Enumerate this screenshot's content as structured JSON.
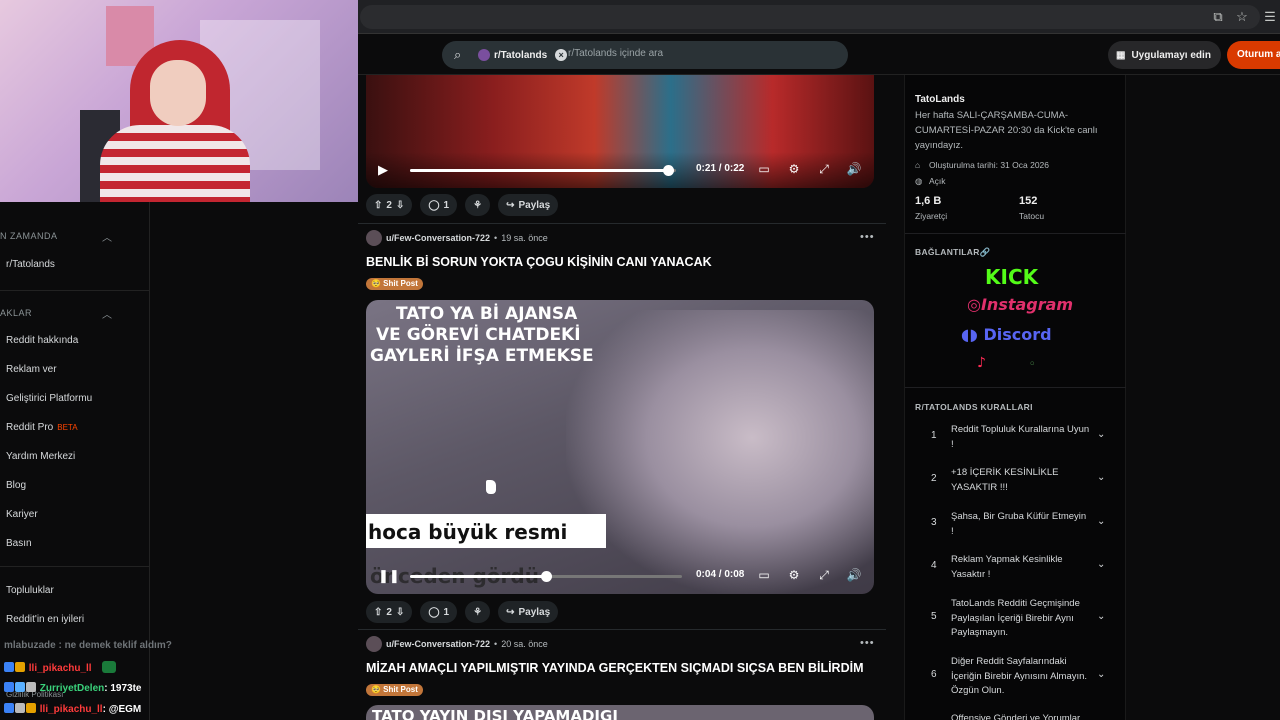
{
  "header": {
    "search_chip": "r/Tatolands",
    "search_placeholder": "r/Tatolands içinde ara",
    "app_button": "Uygulamayı edin",
    "login_button": "Oturum a"
  },
  "left_sidebar": {
    "recent_section": "N ZAMANDA",
    "recent_items": [
      "r/Tatolands"
    ],
    "resources_section": "AKLAR",
    "resource_items": [
      "Reddit hakkında",
      "Reklam ver",
      "Geliştirici Platformu",
      "Reddit Pro",
      "Yardım Merkezi",
      "Blog",
      "Kariyer",
      "Basın"
    ],
    "beta_label": "BETA",
    "bottom_items": [
      "Topluluklar",
      "Reddit'in en iyileri"
    ],
    "privacy": "Gizlilik Politikası"
  },
  "chat": [
    {
      "user": "mlabuzade",
      "text": ": ne demek teklif aldım?",
      "color": "#9aa0a6"
    },
    {
      "user": "lli_pikachu_ll",
      "text": "",
      "color": "#ff3b3b"
    },
    {
      "user": "ZurriyetDelen",
      "text": ": 1973te",
      "color": "#3ad27b"
    },
    {
      "user": "lli_pikachu_ll",
      "text": ": @EGM",
      "color": "#ff3b3b"
    }
  ],
  "posts": [
    {
      "time": "0:21 / 0:22",
      "progress": 0.97,
      "votes": "2",
      "comments": "1",
      "share": "Paylaş"
    },
    {
      "user": "u/Few-Conversation-722",
      "age": "19 sa. önce",
      "title": "BENLİK Bİ SORUN YOKTA ÇOGU KİŞİNİN CANI YANACAK",
      "flair": "🥺 Shit Post",
      "video_caption_top": [
        "TATO YA Bİ AJANSA",
        "VE GÖREVİ CHATDEKİ",
        "GAYLERİ İFŞA ETMEKSE"
      ],
      "video_caption_bottom": [
        "hoca büyük resmi",
        "önceden gördü"
      ],
      "time": "0:04 / 0:08",
      "progress": 0.5,
      "votes": "2",
      "comments": "1",
      "share": "Paylaş"
    },
    {
      "user": "u/Few-Conversation-722",
      "age": "20 sa. önce",
      "title": "MİZAH AMAÇLI YAPILMIŞTIR YAYINDA GERÇEKTEN SIÇMADI SIÇSA BEN BİLİRDİM",
      "flair": "🥺 Shit Post",
      "video_caption_top": [
        "TATO YAYIN DIŞI YAPAMADIGI"
      ]
    }
  ],
  "community": {
    "name": "TatoLands",
    "description": "Her hafta SALI-ÇARŞAMBA-CUMA-CUMARTESİ-PAZAR 20:30 da Kick'te canlı yayındayız.",
    "created": "Oluşturulma tarihi: 31 Oca 2026",
    "visibility": "Açık",
    "visitors": "1,6 B",
    "visitors_label": "Ziyaretçi",
    "members": "152",
    "members_label": "Tatocu",
    "links_head": "BAĞLANTILAR🔗",
    "links": [
      "KICK",
      "Instagram",
      "Discord"
    ],
    "rules_head": "R/TATOLANDS KURALLARI",
    "rules": [
      "Reddit Topluluk Kurallarına Uyun !",
      "+18 İÇERİK KESİNLİKLE YASAKTIR !!!",
      "Şahsa, Bir Gruba Küfür Etmeyin !",
      "Reklam Yapmak Kesinlikle Yasaktır !",
      "TatoLands Redditi Geçmişinde Paylaşılan İçeriği Birebir Aynı Paylaşmayın.",
      "Diğer Reddit Sayfalarındaki İçeriğin Birebir Aynısını Almayın. Özgün Olun.",
      "Offensive Gönderi ve Yorumlar"
    ]
  },
  "colors": {
    "accent": "#d93a00",
    "kick": "#53fc18",
    "instagram": "#e1306c",
    "discord": "#5865f2"
  }
}
